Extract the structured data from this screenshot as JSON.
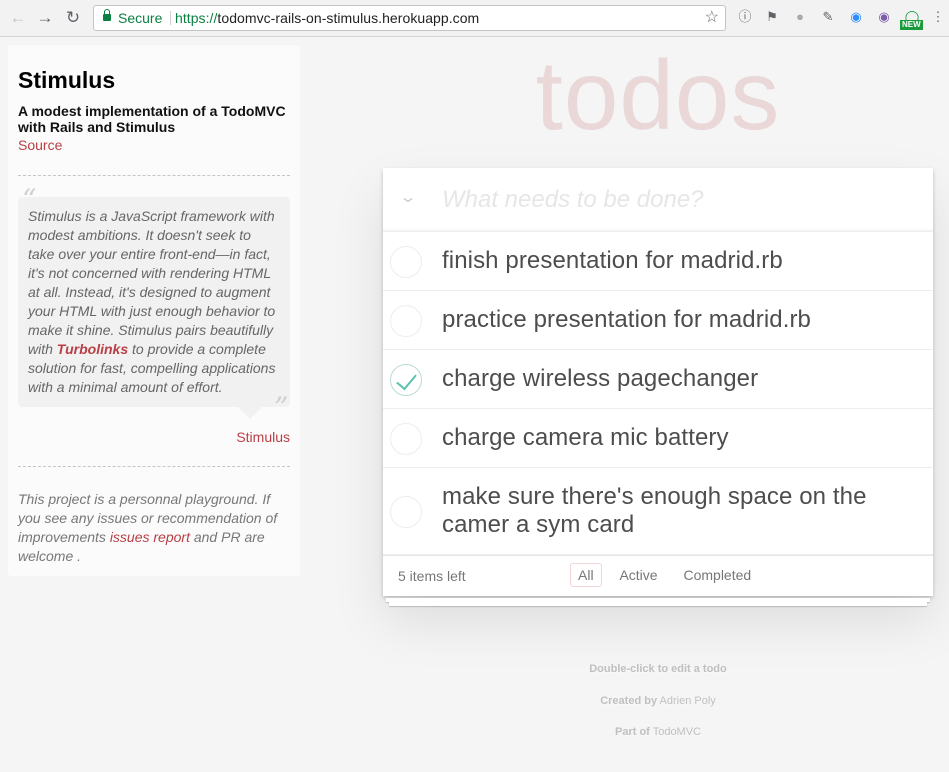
{
  "browser": {
    "secure_label": "Secure",
    "url_protocol": "https://",
    "url_host": "todomvc-rails-on-stimulus.herokuapp.com",
    "new_badge": "NEW"
  },
  "sidebar": {
    "title": "Stimulus",
    "subtitle": "A modest implementation of a TodoMVC with Rails and Stimulus",
    "source_link": "Source",
    "quote_part1": "Stimulus is a JavaScript framework with modest ambitions. It doesn't seek to take over your entire front-end—in fact, it's not concerned with rendering HTML at all. Instead, it's designed to augment your HTML with just enough behavior to make it shine. Stimulus pairs beautifully with ",
    "quote_link": "Turbolinks",
    "quote_part2": " to provide a complete solution for fast, compelling applications with a minimal amount of effort.",
    "quote_author": "Stimulus",
    "note_part1": "This project is a personnal playground. If you see any issues or recommendation of improvements ",
    "note_link": "issues report",
    "note_part2": " and PR are welcome ."
  },
  "app": {
    "title": "todos",
    "toggle_all_icon": "chevron-down-icon",
    "new_todo_placeholder": "What needs to be done?",
    "todos": [
      {
        "label": "finish presentation for madrid.rb",
        "completed": false
      },
      {
        "label": "practice presentation for madrid.rb",
        "completed": false
      },
      {
        "label": "charge wireless pagechanger",
        "completed": true
      },
      {
        "label": "charge camera mic battery",
        "completed": false
      },
      {
        "label": "make sure there's enough space on the camer a sym card",
        "completed": false
      }
    ],
    "footer": {
      "count": "5 items left",
      "filters": [
        "All",
        "Active",
        "Completed"
      ],
      "selected_filter": "All"
    }
  },
  "info": {
    "edit_hint": "Double-click to edit a todo",
    "created_by_label": "Created by",
    "created_by_name": "Adrien Poly",
    "part_of_label": "Part of",
    "part_of_name": "TodoMVC"
  },
  "colors": {
    "accent": "#b83f45",
    "secure_green": "#0b8043",
    "check_green": "#5dc2af",
    "title_pink": "rgba(175,47,47,0.15)"
  }
}
